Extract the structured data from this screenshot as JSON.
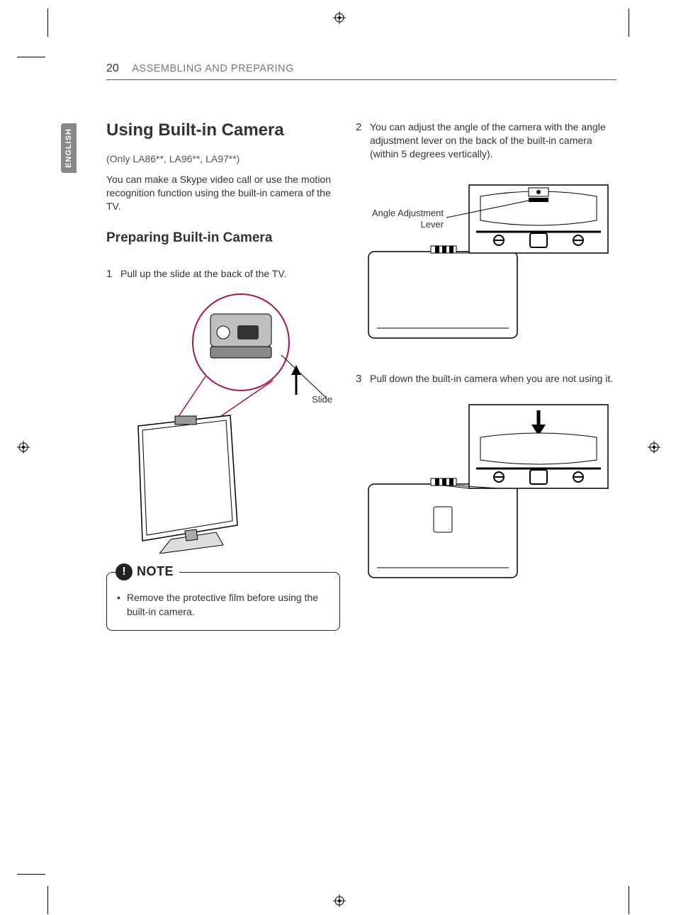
{
  "header": {
    "page_number": "20",
    "section": "ASSEMBLING AND PREPARING"
  },
  "language_tab": "ENGLISH",
  "left": {
    "title": "Using Built-in Camera",
    "models": "(Only LA86**, LA96**, LA97**)",
    "intro": "You can make a Skype video call or use the motion recognition function using the built-in camera of the TV.",
    "subheading": "Preparing Built-in Camera",
    "step1_num": "1",
    "step1_text": "Pull up the slide at the back of the TV.",
    "fig1_label_slide": "Slide",
    "note_heading": "NOTE",
    "note_item1": "Remove the protective film before using the built-in camera."
  },
  "right": {
    "step2_num": "2",
    "step2_text": "You can adjust the angle of the camera with the angle adjustment lever on the back of the built-in camera (within 5 degrees vertically).",
    "fig2_label_angle_l1": "Angle Adjustment",
    "fig2_label_angle_l2": "Lever",
    "step3_num": "3",
    "step3_text": "Pull down the built-in camera when you are not using it."
  }
}
